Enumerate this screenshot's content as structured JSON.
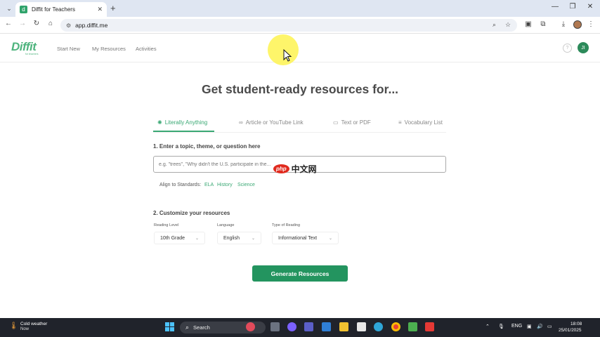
{
  "browser": {
    "tab_title": "Diffit for Teachers",
    "tab_favicon_letter": "d",
    "new_tab_symbol": "+",
    "url": "app.diffit.me",
    "window_controls": {
      "minimize": "—",
      "restore": "❐",
      "close": "✕"
    }
  },
  "header": {
    "logo": "Diffit",
    "logo_sub": "for teachers",
    "nav": [
      "Start New",
      "My Resources",
      "Activities"
    ],
    "help": "?",
    "avatar_initials": "JI"
  },
  "main": {
    "headline": "Get student-ready resources for...",
    "tabs": [
      {
        "label": "Literally Anything",
        "icon": "sparkle-icon"
      },
      {
        "label": "Article or YouTube Link",
        "icon": "link-icon"
      },
      {
        "label": "Text or PDF",
        "icon": "document-icon"
      },
      {
        "label": "Vocabulary List",
        "icon": "list-icon"
      }
    ],
    "section1_title": "1. Enter a topic, theme, or question here",
    "topic_placeholder": "e.g. \"trees\", \"Why didn't the U.S. participate in the...",
    "align_label": "Align to Standards:",
    "standards": [
      "ELA",
      "History",
      "Science"
    ],
    "section2_title": "2. Customize your resources",
    "fields": [
      {
        "label": "Reading Level",
        "value": "10th Grade"
      },
      {
        "label": "Language",
        "value": "English"
      },
      {
        "label": "Type of Reading",
        "value": "Informational Text"
      }
    ],
    "generate_label": "Generate Resources"
  },
  "watermark": {
    "logo": "php",
    "text": "中文网"
  },
  "taskbar": {
    "weather_title": "Cold weather",
    "weather_sub": "Now",
    "search_label": "Search",
    "lang": "ENG",
    "time": "18:08",
    "date": "25/01/2025"
  },
  "colors": {
    "accent": "#3aa874",
    "button": "#23945f",
    "taskbar": "#20232b",
    "highlight": "#fef45a"
  }
}
